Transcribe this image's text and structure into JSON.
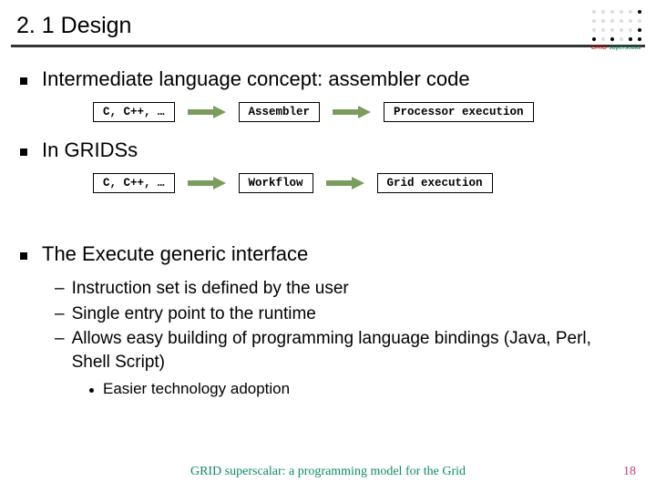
{
  "header": {
    "title": "2. 1 Design",
    "logo_grid": "GRID",
    "logo_super": "superscalar"
  },
  "bullets": {
    "b1": "Intermediate language concept: assembler code",
    "b2": "In GRIDSs",
    "b3": "The Execute generic interface"
  },
  "flow1": {
    "a": "C, C++, …",
    "b": "Assembler",
    "c": "Processor execution"
  },
  "flow2": {
    "a": "C, C++, …",
    "b": "Workflow",
    "c": "Grid execution"
  },
  "sub": {
    "s1": "Instruction set is defined by the user",
    "s2": "Single entry point to the runtime",
    "s3": "Allows easy building of programming language bindings (Java, Perl, Shell Script)",
    "s3a": "Easier technology adoption"
  },
  "footer": {
    "text": "GRID superscalar: a programming model for the Grid",
    "page": "18"
  }
}
